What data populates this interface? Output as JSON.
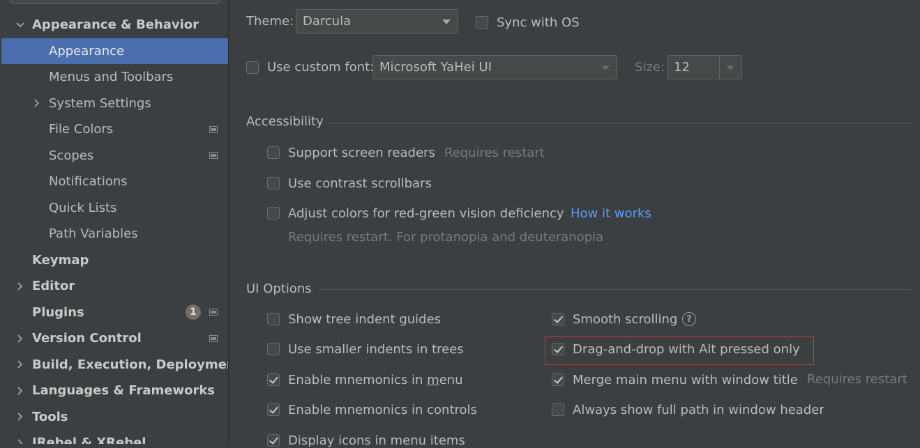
{
  "sidebar": {
    "items": [
      {
        "label": "Appearance & Behavior",
        "level": 0,
        "bold": true,
        "expanded": true
      },
      {
        "label": "Appearance",
        "level": 1,
        "selected": true
      },
      {
        "label": "Menus and Toolbars",
        "level": 1
      },
      {
        "label": "System Settings",
        "level": 1,
        "collapsed": true
      },
      {
        "label": "File Colors",
        "level": 1,
        "project_icon": true
      },
      {
        "label": "Scopes",
        "level": 1,
        "project_icon": true
      },
      {
        "label": "Notifications",
        "level": 1
      },
      {
        "label": "Quick Lists",
        "level": 1
      },
      {
        "label": "Path Variables",
        "level": 1
      },
      {
        "label": "Keymap",
        "level": 0,
        "bold": true
      },
      {
        "label": "Editor",
        "level": 0,
        "bold": true,
        "collapsed": true
      },
      {
        "label": "Plugins",
        "level": 0,
        "bold": true,
        "badge": "1",
        "project_icon": true
      },
      {
        "label": "Version Control",
        "level": 0,
        "bold": true,
        "collapsed": true,
        "project_icon": true
      },
      {
        "label": "Build, Execution, Deployment",
        "level": 0,
        "bold": true,
        "collapsed": true
      },
      {
        "label": "Languages & Frameworks",
        "level": 0,
        "bold": true,
        "collapsed": true
      },
      {
        "label": "Tools",
        "level": 0,
        "bold": true,
        "collapsed": true
      },
      {
        "label": "JRebel & XRebel",
        "level": 0,
        "bold": true,
        "collapsed": true
      }
    ]
  },
  "theme": {
    "label": "Theme:",
    "value": "Darcula",
    "sync_label": "Sync with OS",
    "sync_checked": false
  },
  "font": {
    "custom_label": "Use custom font:",
    "custom_checked": false,
    "value": "Microsoft YaHei UI",
    "size_label": "Size:",
    "size_value": "12"
  },
  "accessibility": {
    "title": "Accessibility",
    "screen_readers": {
      "label": "Support screen readers",
      "hint": "Requires restart",
      "checked": false
    },
    "contrast_scrollbars": {
      "label": "Use contrast scrollbars",
      "checked": false
    },
    "red_green": {
      "label": "Adjust colors for red-green vision deficiency",
      "link": "How it works",
      "note": "Requires restart. For protanopia and deuteranopia",
      "checked": false
    }
  },
  "ui_options": {
    "title": "UI Options",
    "left": [
      {
        "label": "Show tree indent guides",
        "checked": false
      },
      {
        "label": "Use smaller indents in trees",
        "checked": false
      },
      {
        "label_before": "Enable mnemonics in ",
        "mnemonic": "m",
        "label_after": "enu",
        "checked": true
      },
      {
        "label": "Enable mnemonics in controls",
        "checked": true
      },
      {
        "label": "Display icons in menu items",
        "checked": true
      }
    ],
    "right": [
      {
        "label": "Smooth scrolling",
        "checked": true,
        "help": "?"
      },
      {
        "label": "Drag-and-drop with Alt pressed only",
        "checked": true,
        "highlighted": true
      },
      {
        "label": "Merge main menu with window title",
        "checked": true,
        "hint": "Requires restart"
      },
      {
        "label": "Always show full path in window header",
        "checked": false
      }
    ]
  },
  "colors": {
    "background": "#3c3f41",
    "selection": "#4b6eaf",
    "link": "#589df6",
    "highlight_border": "#d9353a"
  }
}
